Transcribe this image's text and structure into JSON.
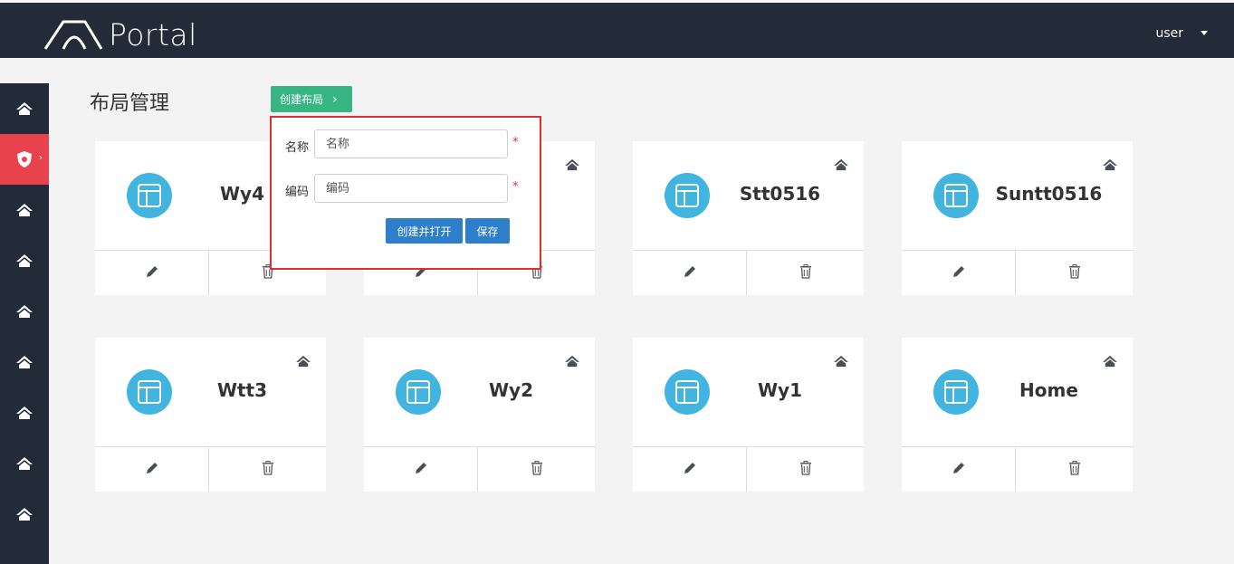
{
  "header": {
    "logo_text": "Portal",
    "user": "user"
  },
  "page": {
    "title": "布局管理",
    "create_button": "创建布局"
  },
  "popup": {
    "name_label": "名称",
    "name_placeholder": "名称",
    "code_label": "编码",
    "code_placeholder": "编码",
    "required_mark": "*",
    "create_open_button": "创建并打开",
    "save_button": "保存"
  },
  "cards": [
    {
      "name": "Wy4"
    },
    {
      "name": ""
    },
    {
      "name": "Stt0516"
    },
    {
      "name": "Suntt0516"
    },
    {
      "name": "Wtt3"
    },
    {
      "name": "Wy2"
    },
    {
      "name": "Wy1"
    },
    {
      "name": "Home"
    }
  ],
  "colors": {
    "header_bg": "#232b38",
    "active_side": "#e8424f",
    "create_btn": "#37b684",
    "primary_btn": "#2e7fcb",
    "avatar": "#41b4df",
    "popup_border": "#e02f2f"
  },
  "icons": {
    "side": "home-icon",
    "side_active": "shield-icon",
    "card_corner": "home-icon",
    "card_avatar": "layout-icon",
    "edit": "pencil-icon",
    "delete": "trash-icon"
  }
}
